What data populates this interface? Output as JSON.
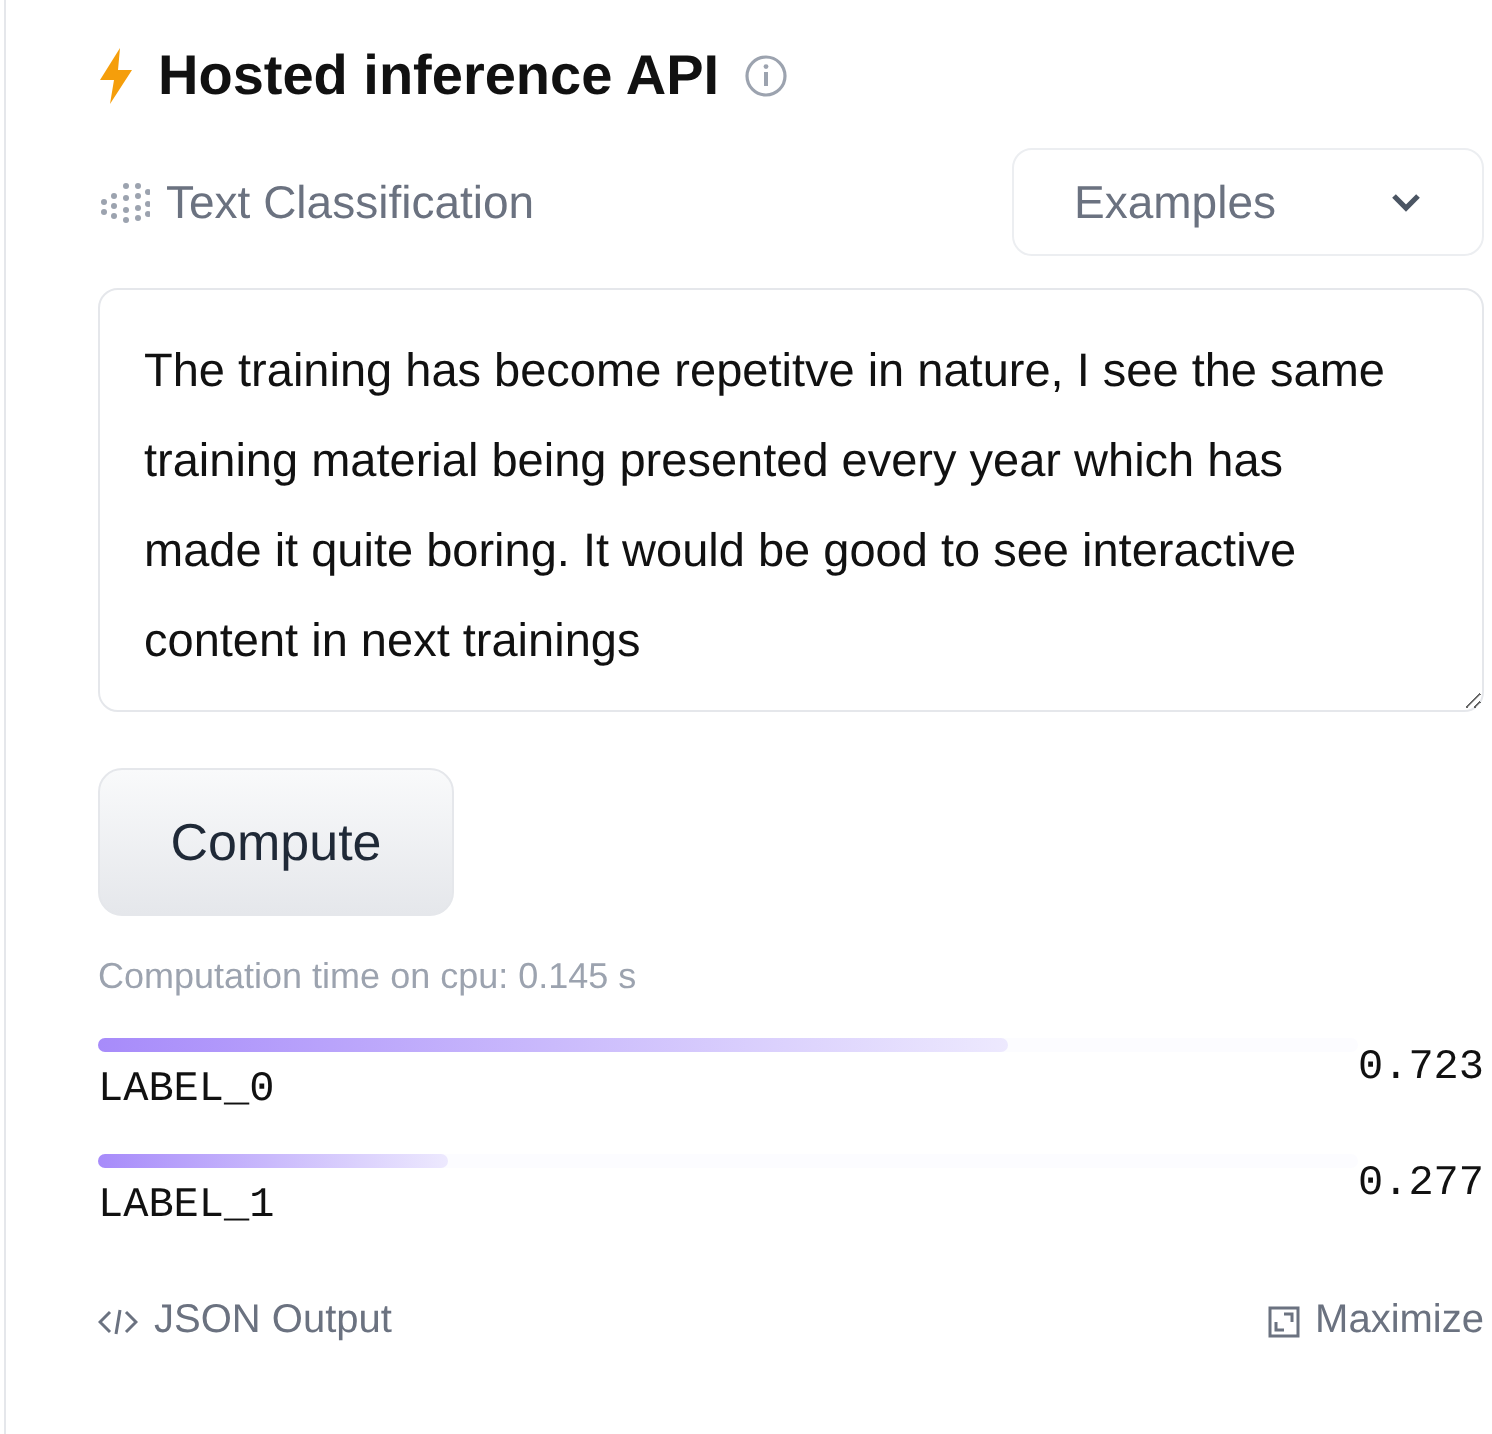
{
  "header": {
    "title": "Hosted inference API"
  },
  "task": {
    "label": "Text Classification"
  },
  "examples": {
    "label": "Examples"
  },
  "input": {
    "value": "The training has become repetitve in nature, I see the same training material being presented every year which has made it quite boring. It would be good to see interactive content in next trainings"
  },
  "compute_button": {
    "label": "Compute"
  },
  "computation_time": "Computation time on cpu: 0.145 s",
  "results": [
    {
      "label": "LABEL_0",
      "score": "0.723",
      "level": 0.723
    },
    {
      "label": "LABEL_1",
      "score": "0.277",
      "level": 0.277
    }
  ],
  "footer": {
    "json_output": "JSON Output",
    "maximize": "Maximize"
  }
}
